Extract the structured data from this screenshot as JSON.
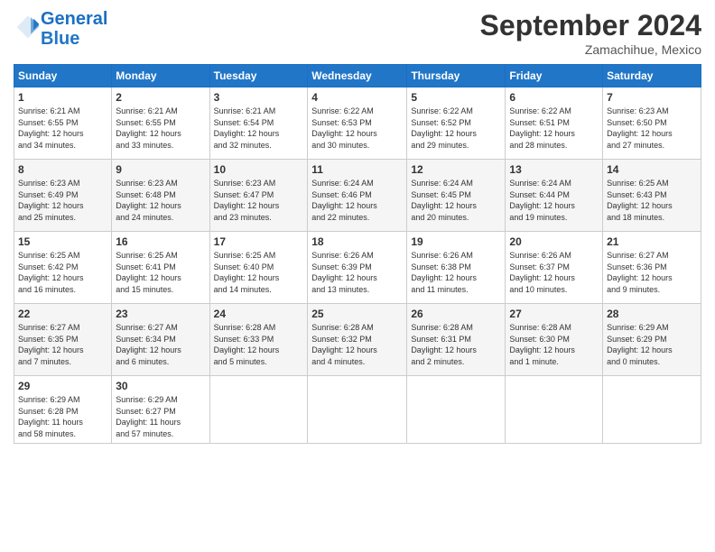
{
  "header": {
    "logo_line1": "General",
    "logo_line2": "Blue",
    "month": "September 2024",
    "location": "Zamachihue, Mexico"
  },
  "weekdays": [
    "Sunday",
    "Monday",
    "Tuesday",
    "Wednesday",
    "Thursday",
    "Friday",
    "Saturday"
  ],
  "weeks": [
    [
      {
        "day": "1",
        "info": "Sunrise: 6:21 AM\nSunset: 6:55 PM\nDaylight: 12 hours\nand 34 minutes."
      },
      {
        "day": "2",
        "info": "Sunrise: 6:21 AM\nSunset: 6:55 PM\nDaylight: 12 hours\nand 33 minutes."
      },
      {
        "day": "3",
        "info": "Sunrise: 6:21 AM\nSunset: 6:54 PM\nDaylight: 12 hours\nand 32 minutes."
      },
      {
        "day": "4",
        "info": "Sunrise: 6:22 AM\nSunset: 6:53 PM\nDaylight: 12 hours\nand 30 minutes."
      },
      {
        "day": "5",
        "info": "Sunrise: 6:22 AM\nSunset: 6:52 PM\nDaylight: 12 hours\nand 29 minutes."
      },
      {
        "day": "6",
        "info": "Sunrise: 6:22 AM\nSunset: 6:51 PM\nDaylight: 12 hours\nand 28 minutes."
      },
      {
        "day": "7",
        "info": "Sunrise: 6:23 AM\nSunset: 6:50 PM\nDaylight: 12 hours\nand 27 minutes."
      }
    ],
    [
      {
        "day": "8",
        "info": "Sunrise: 6:23 AM\nSunset: 6:49 PM\nDaylight: 12 hours\nand 25 minutes."
      },
      {
        "day": "9",
        "info": "Sunrise: 6:23 AM\nSunset: 6:48 PM\nDaylight: 12 hours\nand 24 minutes."
      },
      {
        "day": "10",
        "info": "Sunrise: 6:23 AM\nSunset: 6:47 PM\nDaylight: 12 hours\nand 23 minutes."
      },
      {
        "day": "11",
        "info": "Sunrise: 6:24 AM\nSunset: 6:46 PM\nDaylight: 12 hours\nand 22 minutes."
      },
      {
        "day": "12",
        "info": "Sunrise: 6:24 AM\nSunset: 6:45 PM\nDaylight: 12 hours\nand 20 minutes."
      },
      {
        "day": "13",
        "info": "Sunrise: 6:24 AM\nSunset: 6:44 PM\nDaylight: 12 hours\nand 19 minutes."
      },
      {
        "day": "14",
        "info": "Sunrise: 6:25 AM\nSunset: 6:43 PM\nDaylight: 12 hours\nand 18 minutes."
      }
    ],
    [
      {
        "day": "15",
        "info": "Sunrise: 6:25 AM\nSunset: 6:42 PM\nDaylight: 12 hours\nand 16 minutes."
      },
      {
        "day": "16",
        "info": "Sunrise: 6:25 AM\nSunset: 6:41 PM\nDaylight: 12 hours\nand 15 minutes."
      },
      {
        "day": "17",
        "info": "Sunrise: 6:25 AM\nSunset: 6:40 PM\nDaylight: 12 hours\nand 14 minutes."
      },
      {
        "day": "18",
        "info": "Sunrise: 6:26 AM\nSunset: 6:39 PM\nDaylight: 12 hours\nand 13 minutes."
      },
      {
        "day": "19",
        "info": "Sunrise: 6:26 AM\nSunset: 6:38 PM\nDaylight: 12 hours\nand 11 minutes."
      },
      {
        "day": "20",
        "info": "Sunrise: 6:26 AM\nSunset: 6:37 PM\nDaylight: 12 hours\nand 10 minutes."
      },
      {
        "day": "21",
        "info": "Sunrise: 6:27 AM\nSunset: 6:36 PM\nDaylight: 12 hours\nand 9 minutes."
      }
    ],
    [
      {
        "day": "22",
        "info": "Sunrise: 6:27 AM\nSunset: 6:35 PM\nDaylight: 12 hours\nand 7 minutes."
      },
      {
        "day": "23",
        "info": "Sunrise: 6:27 AM\nSunset: 6:34 PM\nDaylight: 12 hours\nand 6 minutes."
      },
      {
        "day": "24",
        "info": "Sunrise: 6:28 AM\nSunset: 6:33 PM\nDaylight: 12 hours\nand 5 minutes."
      },
      {
        "day": "25",
        "info": "Sunrise: 6:28 AM\nSunset: 6:32 PM\nDaylight: 12 hours\nand 4 minutes."
      },
      {
        "day": "26",
        "info": "Sunrise: 6:28 AM\nSunset: 6:31 PM\nDaylight: 12 hours\nand 2 minutes."
      },
      {
        "day": "27",
        "info": "Sunrise: 6:28 AM\nSunset: 6:30 PM\nDaylight: 12 hours\nand 1 minute."
      },
      {
        "day": "28",
        "info": "Sunrise: 6:29 AM\nSunset: 6:29 PM\nDaylight: 12 hours\nand 0 minutes."
      }
    ],
    [
      {
        "day": "29",
        "info": "Sunrise: 6:29 AM\nSunset: 6:28 PM\nDaylight: 11 hours\nand 58 minutes."
      },
      {
        "day": "30",
        "info": "Sunrise: 6:29 AM\nSunset: 6:27 PM\nDaylight: 11 hours\nand 57 minutes."
      },
      null,
      null,
      null,
      null,
      null
    ]
  ]
}
